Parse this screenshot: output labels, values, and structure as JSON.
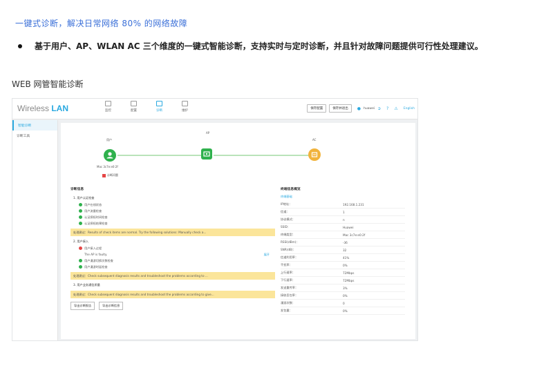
{
  "doc": {
    "heading": "一键式诊断，解决日常网络 80% 的网络故障",
    "bullet": "基于用户、AP、WLAN AC 三个维度的一键式智能诊断，支持实时与定时诊断，并且针对故障问题提供可行性处理建议。",
    "section_title": "WEB 网管智能诊断"
  },
  "app": {
    "logo_prefix": "Wireless ",
    "logo_accent": "LAN",
    "nav": [
      {
        "label": "监控"
      },
      {
        "label": "配置"
      },
      {
        "label": "诊断"
      },
      {
        "label": "维护"
      }
    ],
    "top_buttons": [
      "保存配置",
      "保存并退出"
    ],
    "user": "huawei",
    "language": "English",
    "colors": {
      "accent": "#2aa9e0",
      "ok": "#2fb14d",
      "error": "#e54545",
      "warn": "#f1b33c",
      "suggest_bg": "#fbe59a"
    }
  },
  "sidebar": {
    "items": [
      {
        "label": "智能诊断",
        "active": true
      },
      {
        "label": "诊断工具",
        "active": false
      }
    ]
  },
  "flow": {
    "user_caption": "用户",
    "user_sub": "Mac 3c7e:e0:2f",
    "fault_label": "诊断问题",
    "ap_caption": "AP",
    "ac_caption": "AC"
  },
  "diagnosis": {
    "title": "诊断信息",
    "group1": "1. 用户认证检查",
    "group1_items": [
      "用户在线状态",
      "用户流量检查",
      "认证授权时间检查",
      "认证授权结果检查"
    ],
    "suggest1": "处理建议：Results of check items are normal. Try the following solutions: Manually check a...",
    "group2": "2. 用户接入",
    "group2_item1": "用户接入过程",
    "group2_plain": "The AP is faulty.",
    "group2_link": "展开",
    "group2_items": [
      "用户漫游切换次数检查",
      "用户漫游时延检查"
    ],
    "suggest2": "处理建议：Check subsequent diagnosis results and troubleshoot the problems according to ...",
    "group3": "3. 用户业务通信质量",
    "suggest3": "处理建议：Check subsequent diagnosis results and troubleshoot the problems according to give...",
    "buttons": [
      "导出诊断报告",
      "导出诊断信息"
    ]
  },
  "terminal": {
    "title": "终端信息概览",
    "subtitle": "终端基础",
    "rows": [
      {
        "k": "IP地址：",
        "v": "192.168.1.231"
      },
      {
        "k": "信道：",
        "v": "1"
      },
      {
        "k": "协议模式：",
        "v": "n"
      },
      {
        "k": "SSID：",
        "v": "Huawei"
      },
      {
        "k": "终端类型：",
        "v": "Mac 3c7e:e0:2f"
      },
      {
        "k": "RSSI(dBm)：",
        "v": "-36"
      },
      {
        "k": "SNR(dB)：",
        "v": "32"
      },
      {
        "k": "信道利用率：",
        "v": "41%"
      },
      {
        "k": "干扰率：",
        "v": "0%"
      },
      {
        "k": "上行速率：",
        "v": "72Mbps"
      },
      {
        "k": "下行速率：",
        "v": "72Mbps"
      },
      {
        "k": "发送重传率：",
        "v": "3%"
      },
      {
        "k": "接收丢包率：",
        "v": "0%"
      },
      {
        "k": "漫游次数：",
        "v": "0"
      },
      {
        "k": "发包量：",
        "v": "0%"
      }
    ]
  }
}
